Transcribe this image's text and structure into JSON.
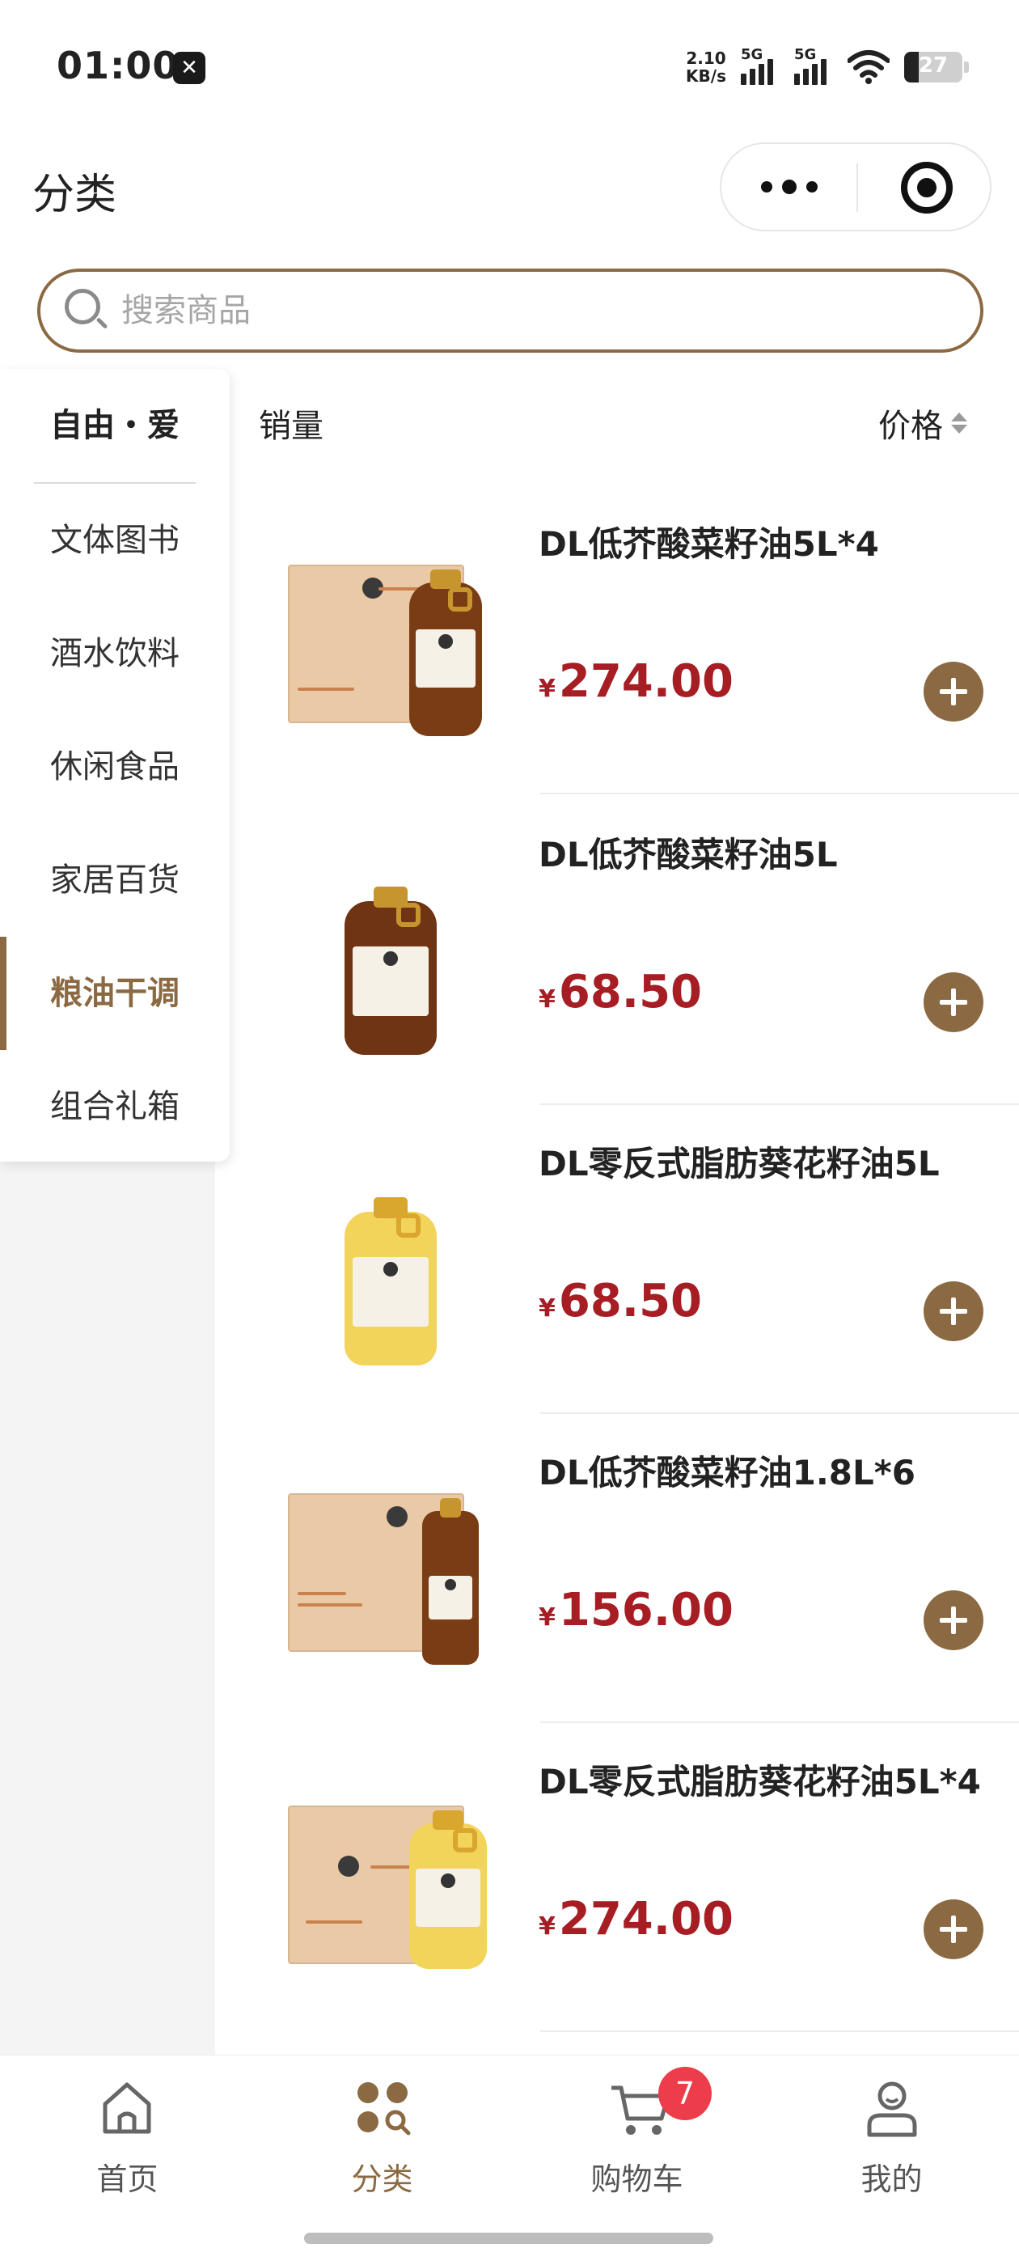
{
  "status_bar": {
    "time": "01:00",
    "net_speed_value": "2.10",
    "net_speed_unit": "KB/s",
    "signal1_label": "5G",
    "signal2_label": "5G",
    "battery": "27"
  },
  "header": {
    "title": "分类"
  },
  "search": {
    "placeholder": "搜索商品",
    "value": ""
  },
  "sidebar": {
    "header": "自由・爱",
    "items": [
      {
        "label": "文体图书",
        "active": false
      },
      {
        "label": "酒水饮料",
        "active": false
      },
      {
        "label": "休闲食品",
        "active": false
      },
      {
        "label": "家居百货",
        "active": false
      },
      {
        "label": "粮油干调",
        "active": true
      },
      {
        "label": "组合礼箱",
        "active": false
      }
    ]
  },
  "sort": {
    "sales_label": "销量",
    "price_label": "价格"
  },
  "products": [
    {
      "name": "DL低芥酸菜籽油5L*4",
      "currency": "¥",
      "price": "274.00",
      "image": "canola-oil-box-of-4"
    },
    {
      "name": "DL低芥酸菜籽油5L",
      "currency": "¥",
      "price": "68.50",
      "image": "canola-oil-jug"
    },
    {
      "name": "DL零反式脂肪葵花籽油5L",
      "currency": "¥",
      "price": "68.50",
      "image": "sunflower-oil-jug"
    },
    {
      "name": "DL低芥酸菜籽油1.8L*6",
      "currency": "¥",
      "price": "156.00",
      "image": "canola-oil-box-of-6"
    },
    {
      "name": "DL零反式脂肪葵花籽油5L*4",
      "currency": "¥",
      "price": "274.00",
      "image": "sunflower-oil-box-of-4"
    }
  ],
  "tabbar": {
    "home": "首页",
    "category": "分类",
    "cart": "购物车",
    "cart_badge": "7",
    "mine": "我的"
  },
  "colors": {
    "accent": "#8b6a43",
    "price": "#a61d24",
    "badge": "#ee3d4a"
  }
}
